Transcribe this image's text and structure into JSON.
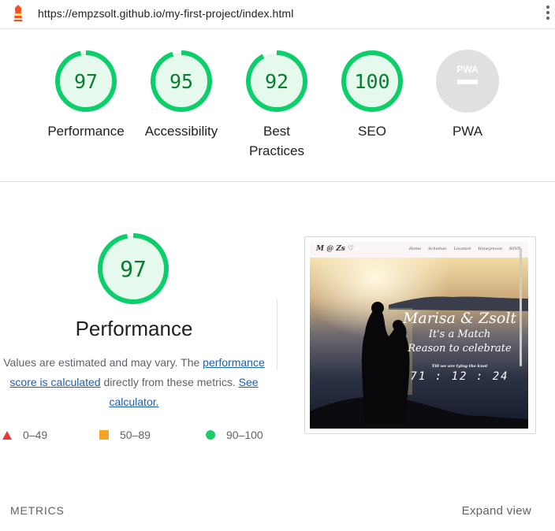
{
  "header": {
    "url": "https://empzsolt.github.io/my-first-project/index.html",
    "logo_icon": "lighthouse-icon",
    "menu_icon": "kebab-menu-icon"
  },
  "colors": {
    "pass": "#0c7b33",
    "pass_ring": "#0cce6b",
    "pass_fill": "#e5f9ec",
    "average": "#f4a427",
    "fail": "#e53935",
    "na": "#e0e0e0"
  },
  "gauges": [
    {
      "label": "Performance",
      "score": 97,
      "display": "97"
    },
    {
      "label": "Accessibility",
      "score": 95,
      "display": "95"
    },
    {
      "label": "Best Practices",
      "label_lines": [
        "Best",
        "Practices"
      ],
      "score": 92,
      "display": "92"
    },
    {
      "label": "SEO",
      "score": 100,
      "display": "100"
    },
    {
      "label": "PWA",
      "score": null,
      "display": "PWA"
    }
  ],
  "performance": {
    "score": 97,
    "display": "97",
    "title": "Performance",
    "desc_pre": "Values are estimated and may vary. The ",
    "desc_link": "performance score is calculated",
    "desc_mid": " directly from these metrics. ",
    "desc_link2": "See calculator.",
    "legend": [
      {
        "range": "0–49",
        "icon": "fail-triangle-icon"
      },
      {
        "range": "50–89",
        "icon": "average-square-icon"
      },
      {
        "range": "90–100",
        "icon": "pass-circle-icon"
      }
    ]
  },
  "thumbnail": {
    "brand": "M @ Zs ♡",
    "nav": [
      "Home",
      "Schedule",
      "Location",
      "Honeymoon",
      "RSVP"
    ],
    "title": "Marisa & Zsolt",
    "subtitle1": "It's a Match",
    "subtitle2": "Reason to celebrate",
    "countdown_label": "Till we are tying the knot",
    "countdown": "71 : 12 : 24"
  },
  "footer": {
    "metrics_label": "METRICS",
    "expand_label": "Expand view"
  }
}
